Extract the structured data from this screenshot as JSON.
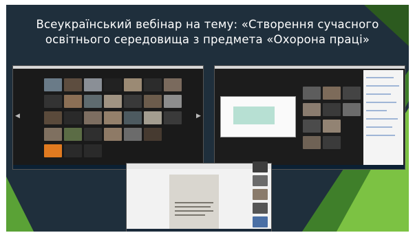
{
  "slide": {
    "title_line_1": "Всеукраїнський вебінар на тему: «Створення сучасного",
    "title_line_2": "освітнього середовища з предмета «Охорона праці»"
  },
  "colors": {
    "background": "#1f2f3c",
    "accent_green": "#7cc243",
    "dark_green": "#3f7f2a",
    "title_text": "#ffffff"
  },
  "screenshots": [
    {
      "name": "zoom-gallery-view",
      "icons": [
        "video-tile-icon"
      ]
    },
    {
      "name": "zoom-shared-screen-view",
      "icons": [
        "presentation-icon"
      ]
    },
    {
      "name": "word-document-share-view",
      "icons": [
        "document-icon"
      ]
    }
  ]
}
